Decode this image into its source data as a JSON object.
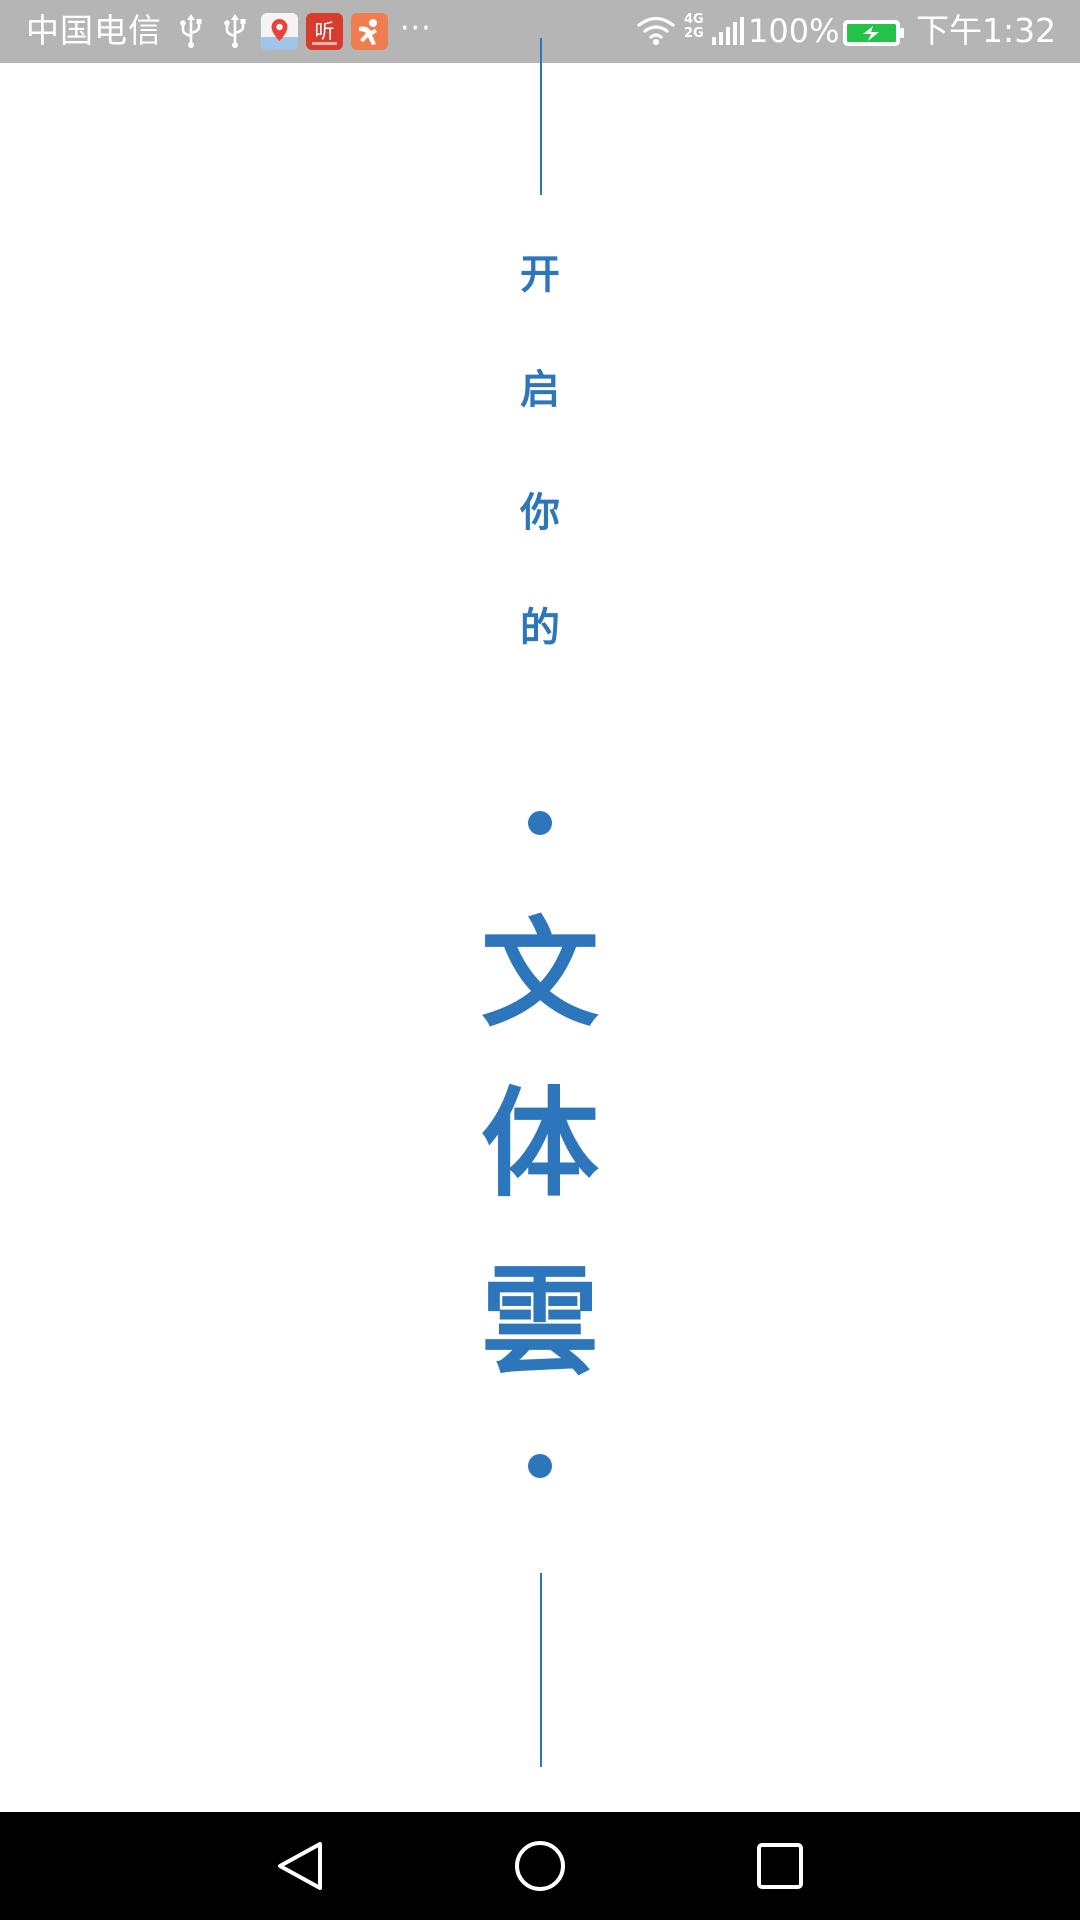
{
  "status_bar": {
    "carrier": "中国电信",
    "more": "···",
    "network_label_top": "4G",
    "network_label_bottom": "2G",
    "battery_percent": "100%",
    "time": "下午1:32",
    "notification_icons": [
      "usb-icon",
      "usb-icon",
      "baidu-map-app-icon",
      "ting-app-icon",
      "person-app-icon"
    ],
    "app_icon_ting_text": "听",
    "colors": {
      "bar_background": "#b5b5b5",
      "battery_fill": "#25c24a"
    }
  },
  "splash": {
    "intro_chars": [
      "开",
      "启",
      "你",
      "的"
    ],
    "brand_chars": [
      "文",
      "体",
      "雲"
    ],
    "accent_color": "#2e76bc"
  },
  "nav_bar": {
    "buttons": [
      "back-icon",
      "home-icon",
      "recents-icon"
    ]
  }
}
